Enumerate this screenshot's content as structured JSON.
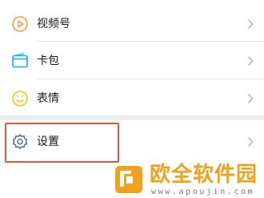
{
  "menu": {
    "items": [
      {
        "label": "视频号",
        "icon": "video-channel-icon",
        "icon_color": "#fa9d3b"
      },
      {
        "label": "卡包",
        "icon": "card-wallet-icon",
        "icon_color": "#10aeff"
      },
      {
        "label": "表情",
        "icon": "emoji-icon",
        "icon_color": "#ffc300"
      }
    ],
    "settings": {
      "label": "设置",
      "icon": "gear-icon",
      "icon_color": "#576b95"
    }
  },
  "colors": {
    "highlight_border": "#e5553f",
    "page_background": "#ededed",
    "watermark_orange": "#f2a11b"
  },
  "watermark": {
    "title": "欧全软件园",
    "url": "www.apoujin.com"
  }
}
